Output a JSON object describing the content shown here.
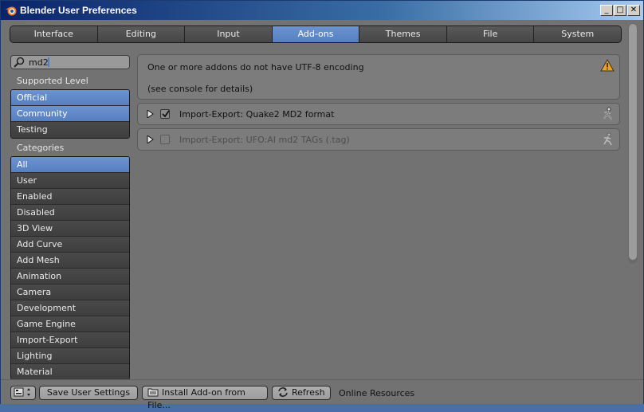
{
  "window": {
    "title": "Blender User Preferences",
    "controls": {
      "minimize": "_",
      "maximize": "□",
      "close": "✕"
    }
  },
  "tabs": [
    {
      "label": "Interface",
      "active": false
    },
    {
      "label": "Editing",
      "active": false
    },
    {
      "label": "Input",
      "active": false
    },
    {
      "label": "Add-ons",
      "active": true
    },
    {
      "label": "Themes",
      "active": false
    },
    {
      "label": "File",
      "active": false
    },
    {
      "label": "System",
      "active": false
    }
  ],
  "search": {
    "value": "md2",
    "icon": "search-icon"
  },
  "supported_level": {
    "label": "Supported Level",
    "items": [
      {
        "label": "Official",
        "selected": true
      },
      {
        "label": "Community",
        "selected": true
      },
      {
        "label": "Testing",
        "selected": false
      }
    ]
  },
  "categories": {
    "label": "Categories",
    "items": [
      {
        "label": "All",
        "selected": true
      },
      {
        "label": "User",
        "selected": false
      },
      {
        "label": "Enabled",
        "selected": false
      },
      {
        "label": "Disabled",
        "selected": false
      },
      {
        "label": "3D View",
        "selected": false
      },
      {
        "label": "Add Curve",
        "selected": false
      },
      {
        "label": "Add Mesh",
        "selected": false
      },
      {
        "label": "Animation",
        "selected": false
      },
      {
        "label": "Camera",
        "selected": false
      },
      {
        "label": "Development",
        "selected": false
      },
      {
        "label": "Game Engine",
        "selected": false
      },
      {
        "label": "Import-Export",
        "selected": false
      },
      {
        "label": "Lighting",
        "selected": false
      },
      {
        "label": "Material",
        "selected": false
      }
    ]
  },
  "warning": {
    "line1": "One or more addons do not have UTF-8 encoding",
    "line2": "(see console for details)",
    "icon": "warning-icon"
  },
  "addons": [
    {
      "label": "Import-Export: Quake2 MD2 format",
      "enabled": true
    },
    {
      "label": "Import-Export: UFO:AI md2 TAGs (.tag)",
      "enabled": false
    }
  ],
  "bottom": {
    "save": "Save User Settings",
    "install": "Install Add-on from File...",
    "refresh": "Refresh",
    "online": "Online Resources"
  },
  "colors": {
    "accent": "#5680c2",
    "background": "#727272",
    "warning": "#f0a020"
  }
}
